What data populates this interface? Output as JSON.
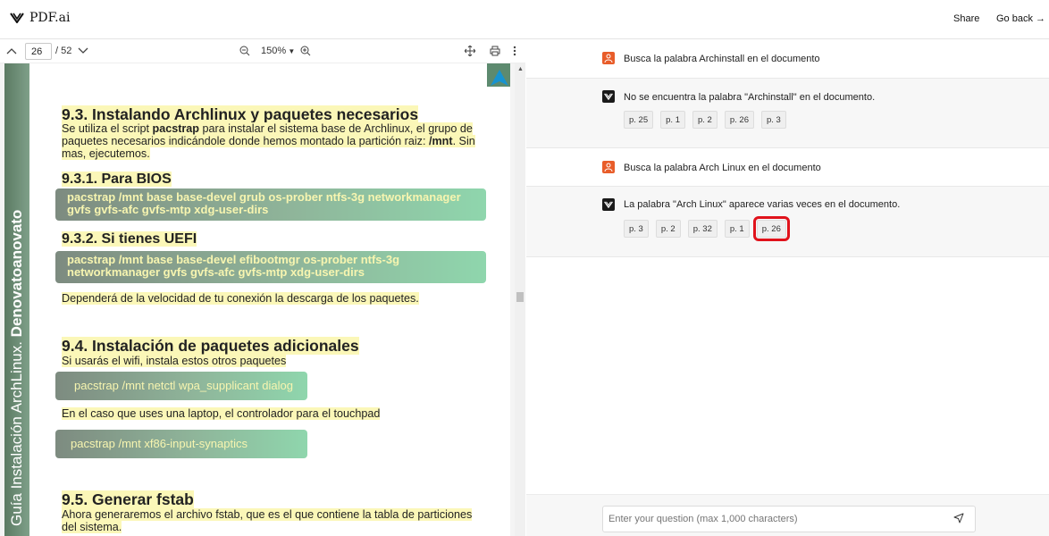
{
  "header": {
    "logo_text": "PDF.ai",
    "share_label": "Share",
    "go_back_label": "Go back →"
  },
  "viewer_toolbar": {
    "current_page": "26",
    "total_pages": "/ 52",
    "zoom": "150%"
  },
  "document": {
    "side_text_regular": "Guía Instalación ArchLinux. ",
    "side_text_bold": "Denovatoanovato",
    "h_9_3": "9.3. Instalando Archlinux y paquetes necesarios",
    "p_9_3_a": "Se utiliza el script ",
    "p_9_3_b": "pacstrap",
    "p_9_3_c": " para instalar el sistema base de Archlinux, el grupo de paquetes necesarios indicándole donde hemos montado la partición raiz: ",
    "p_9_3_d": "/mnt",
    "p_9_3_e": ". Sin mas, ejecutemos.",
    "h_9_3_1": "9.3.1. Para BIOS",
    "code_bios": "pacstrap /mnt base base-devel grub os-prober ntfs-3g networkmanager gvfs gvfs-afc gvfs-mtp xdg-user-dirs",
    "h_9_3_2": "9.3.2. Si tienes UEFI",
    "code_uefi": "pacstrap /mnt base base-devel efibootmgr os-prober ntfs-3g networkmanager gvfs gvfs-afc gvfs-mtp xdg-user-dirs",
    "p_speed": "Dependerá de la velocidad de tu conexión la descarga de los paquetes.",
    "h_9_4": "9.4. Instalación de paquetes adicionales",
    "p_wifi": "Si usarás el wifi, instala estos otros paquetes",
    "code_wifi": "pacstrap /mnt netctl wpa_supplicant dialog",
    "p_laptop": "En el caso que uses una laptop, el controlador para el touchpad",
    "code_touchpad": "pacstrap /mnt xf86-input-synaptics",
    "h_9_5": "9.5. Generar fstab",
    "p_fstab": "Ahora generaremos el archivo fstab, que es el que contiene la tabla de particiones del sistema."
  },
  "chat": {
    "messages": [
      {
        "role": "user",
        "text": "Busca la palabra Archinstall en el documento"
      },
      {
        "role": "ai",
        "text": "No se encuentra la palabra \"Archinstall\" en el documento.",
        "pages": [
          "p. 25",
          "p. 1",
          "p. 2",
          "p. 26",
          "p. 3"
        ]
      },
      {
        "role": "user",
        "text": "Busca la palabra Arch Linux en el documento"
      },
      {
        "role": "ai",
        "text": "La palabra \"Arch Linux\" aparece varias veces en el documento.",
        "pages": [
          "p. 3",
          "p. 2",
          "p. 32",
          "p. 1",
          "p. 26"
        ]
      }
    ],
    "input_placeholder": "Enter your question (max 1,000 characters)"
  },
  "colors": {
    "user_avatar": "#e85d2a",
    "ai_avatar": "#1a1a1a",
    "highlight_box": "#e0121b",
    "doc_band": "#5b7a63"
  }
}
